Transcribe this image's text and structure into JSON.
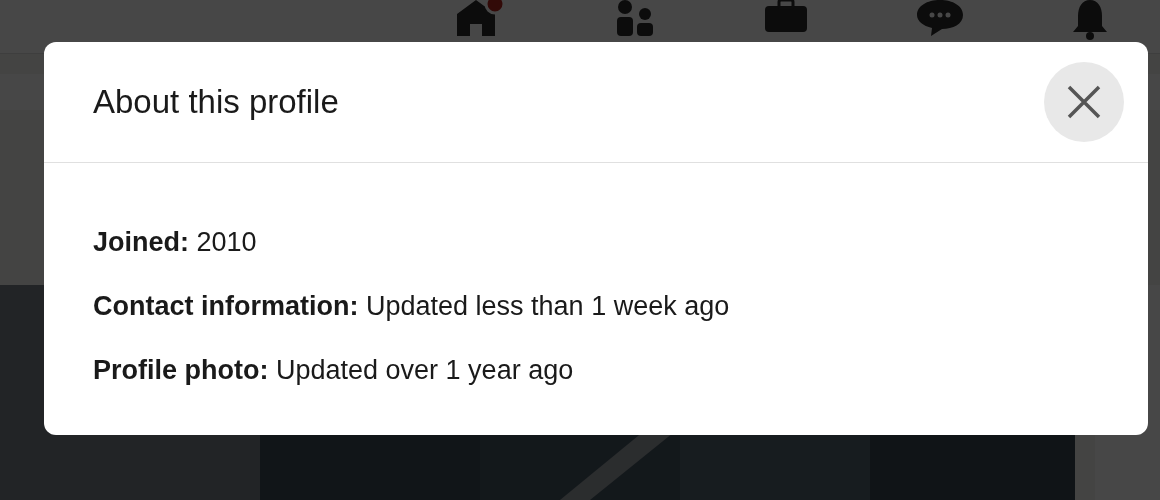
{
  "dialog": {
    "title": "About this profile",
    "items": [
      {
        "text": "**Joined:** 2010"
      },
      {
        "text": "**Contact information:** Updated less than 1 week ago"
      },
      {
        "text": "**Profile photo:** Updated over 1 year ago"
      }
    ]
  }
}
